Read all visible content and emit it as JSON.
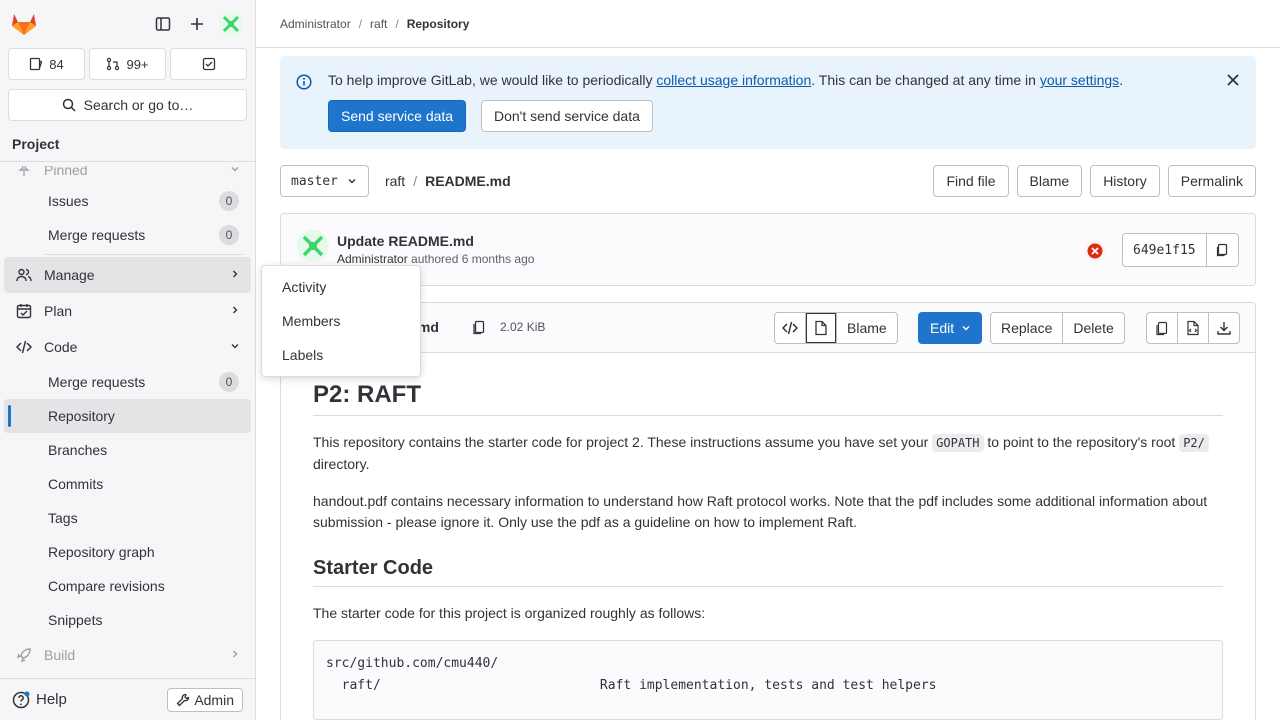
{
  "sidebar": {
    "counts": {
      "issues": "84",
      "merge_requests": "99+"
    },
    "search_label": "Search or go to…",
    "section_title": "Project",
    "pinned_label": "Pinned",
    "pinned_items": [
      {
        "label": "Issues",
        "badge": "0"
      },
      {
        "label": "Merge requests",
        "badge": "0"
      }
    ],
    "groups": {
      "manage": "Manage",
      "plan": "Plan",
      "code": "Code",
      "build": "Build"
    },
    "code_items": [
      {
        "label": "Merge requests",
        "badge": "0"
      },
      {
        "label": "Repository"
      },
      {
        "label": "Branches"
      },
      {
        "label": "Commits"
      },
      {
        "label": "Tags"
      },
      {
        "label": "Repository graph"
      },
      {
        "label": "Compare revisions"
      },
      {
        "label": "Snippets"
      }
    ],
    "help_label": "Help",
    "admin_label": "Admin"
  },
  "flyout": {
    "items": [
      "Activity",
      "Members",
      "Labels"
    ]
  },
  "breadcrumb": {
    "root": "Administrator",
    "project": "raft",
    "current": "Repository"
  },
  "banner": {
    "text_1": "To help improve GitLab, we would like to periodically ",
    "link_1": "collect usage information",
    "text_2": ". This can be changed at any time in ",
    "link_2": "your settings",
    "text_3": ".",
    "send_label": "Send service data",
    "dont_send_label": "Don't send service data"
  },
  "file_nav": {
    "branch": "master",
    "project": "raft",
    "file": "README.md",
    "buttons": [
      "Find file",
      "Blame",
      "History",
      "Permalink"
    ]
  },
  "commit": {
    "title": "Update README.md",
    "author": "Administrator",
    "authored": "authored 6 months ago",
    "sha": "649e1f15",
    "status_color": "#dd2b0e"
  },
  "file_header": {
    "name_visible": "ME.md",
    "size": "2.02 KiB",
    "blame_label": "Blame",
    "edit_label": "Edit",
    "replace_label": "Replace",
    "delete_label": "Delete"
  },
  "readme": {
    "h1": "P2: RAFT",
    "p1_a": "This repository contains the starter code for project 2. These instructions assume you have set your ",
    "p1_code1": "GOPATH",
    "p1_b": " to point to the repository's root ",
    "p1_code2": "P2/",
    "p1_c": " directory.",
    "p2": "handout.pdf contains necessary information to understand how Raft protocol works. Note that the pdf includes some additional information about submission - please ignore it. Only use the pdf as a guideline on how to implement Raft.",
    "h2": "Starter Code",
    "p3": "The starter code for this project is organized roughly as follows:",
    "code_line1": "src/github.com/cmu440/",
    "code_line2": "  raft/                            Raft implementation, tests and test helpers"
  },
  "colors": {
    "accent": "#1f75cb",
    "banner_bg": "#e9f3fc",
    "sidebar_bg": "#f6f6f8"
  }
}
